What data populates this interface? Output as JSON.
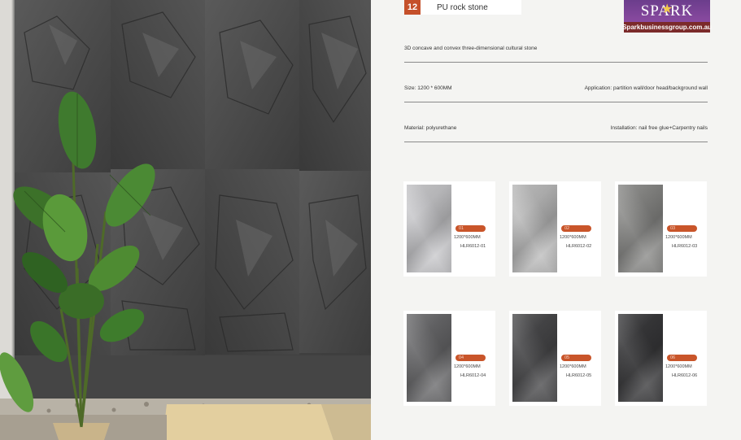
{
  "page_number": "12",
  "title": "PU rock stone",
  "logo": {
    "brand": "SPARK",
    "website": "Sparkbusinessgroup.com.au"
  },
  "specs": {
    "description": "3D concave and convex three-dimensional cultural stone",
    "size": "Size: 1200 * 600MM",
    "application": "Application: partition wall/door head/background wall",
    "material": "Material: polyurethane",
    "installation": "Installation: nail free glue+Carpentry nails"
  },
  "products": [
    {
      "index": "01",
      "size": "1200*600MM",
      "code": "HLR6012-01",
      "color": "#c9c9cc"
    },
    {
      "index": "02",
      "size": "1200*600MM",
      "code": "HLR6012-02",
      "color": "#bdbdbd"
    },
    {
      "index": "03",
      "size": "1200*600MM",
      "code": "HLR6012-03",
      "color": "#8a8a88"
    },
    {
      "index": "04",
      "size": "1200*600MM",
      "code": "HLR6012-04",
      "color": "#6a6a6c"
    },
    {
      "index": "05",
      "size": "1200*600MM",
      "code": "HLR6012-05",
      "color": "#4a4a4c"
    },
    {
      "index": "06",
      "size": "1200*600MM",
      "code": "HLR6012-06",
      "color": "#3a3a3c"
    }
  ]
}
